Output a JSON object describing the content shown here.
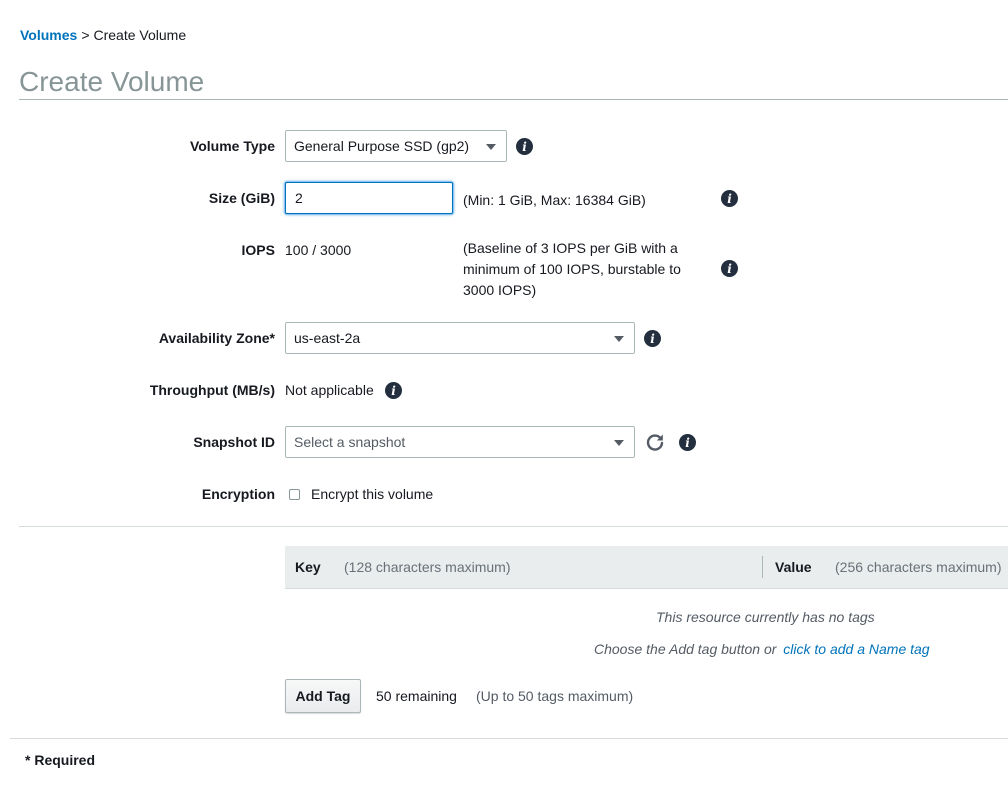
{
  "breadcrumb": {
    "parent": "Volumes",
    "separator": ">",
    "current": "Create Volume"
  },
  "page_title": "Create Volume",
  "form": {
    "volume_type": {
      "label": "Volume Type",
      "value": "General Purpose SSD (gp2)"
    },
    "size": {
      "label": "Size (GiB)",
      "value": "2",
      "hint": "(Min: 1 GiB, Max: 16384 GiB)"
    },
    "iops": {
      "label": "IOPS",
      "value": "100 / 3000",
      "hint_line1": "(Baseline of 3 IOPS per GiB with a",
      "hint_line2": "minimum of 100 IOPS, burstable to",
      "hint_line3": "3000 IOPS)"
    },
    "availability_zone": {
      "label": "Availability Zone*",
      "value": "us-east-2a"
    },
    "throughput": {
      "label": "Throughput (MB/s)",
      "value": "Not applicable"
    },
    "snapshot": {
      "label": "Snapshot ID",
      "placeholder": "Select a snapshot"
    },
    "encryption": {
      "label": "Encryption",
      "checkbox_label": "Encrypt this volume",
      "checked": false
    }
  },
  "tags": {
    "key_header": "Key",
    "key_hint": "(128 characters maximum)",
    "value_header": "Value",
    "value_hint": "(256 characters maximum)",
    "empty_message": "This resource currently has no tags",
    "add_hint_prefix": "Choose the Add tag button or",
    "add_name_link": "click to add a Name tag",
    "add_button": "Add Tag",
    "remaining": "50 remaining",
    "limit_hint": "(Up to 50 tags maximum)"
  },
  "footer": {
    "required_note": "* Required"
  },
  "colors": {
    "link": "#0073bb",
    "title": "#879596",
    "info_icon": "#232f3e"
  },
  "icons": {
    "info": "info-icon",
    "refresh": "refresh-icon",
    "dropdown": "caret-down-icon"
  }
}
